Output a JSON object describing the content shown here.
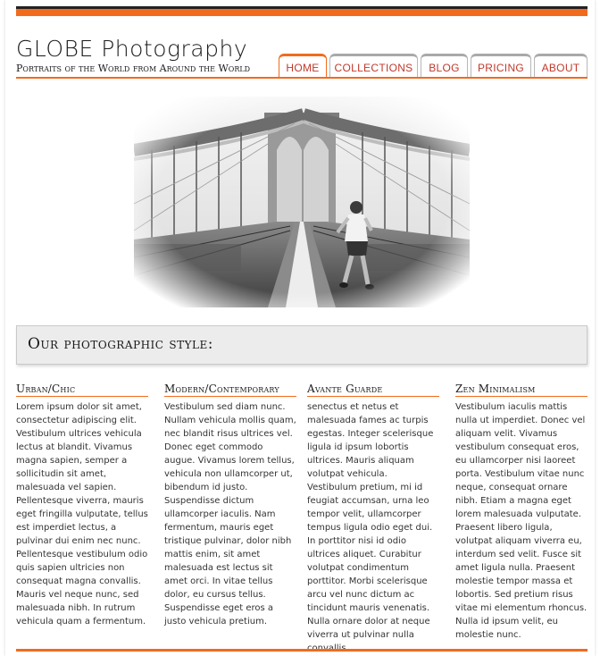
{
  "header": {
    "title": "GLOBE Photography",
    "subtitle": "Portraits of the World from Around the World"
  },
  "nav": {
    "items": [
      {
        "label": "HOME",
        "active": true
      },
      {
        "label": "COLLECTIONS",
        "active": false
      },
      {
        "label": "BLOG",
        "active": false
      },
      {
        "label": "PRICING",
        "active": false
      },
      {
        "label": "ABOUT",
        "active": false
      }
    ]
  },
  "hero": {
    "description": "Black and white photo of a man running on the Brooklyn Bridge walkway"
  },
  "style_section": {
    "heading": "Our photographic style:"
  },
  "columns": [
    {
      "heading": "Urban/Chic",
      "text": "Lorem ipsum dolor sit amet, consectetur adipiscing elit. Vestibulum ultrices vehicula lectus at blandit. Vivamus magna sapien, semper a sollicitudin sit amet, malesuada vel sapien. Pellentesque viverra, mauris eget fringilla vulputate, tellus est imperdiet lectus, a pulvinar dui enim nec nunc. Pellentesque vestibulum odio quis sapien ultricies non consequat magna convallis. Mauris vel neque nunc, sed malesuada nibh. In rutrum vehicula quam a fermentum."
    },
    {
      "heading": "Modern/Contemporary",
      "text": "Vestibulum sed diam nunc. Nullam vehicula mollis quam, nec blandit risus ultrices vel. Donec eget commodo augue. Vivamus lorem tellus, vehicula non ullamcorper ut, bibendum id justo. Suspendisse dictum ullamcorper iaculis. Nam fermentum, mauris eget tristique pulvinar, dolor nibh mattis enim, sit amet malesuada est lectus sit amet orci. In vitae tellus dolor, eu cursus tellus. Suspendisse eget eros a justo vehicula pretium."
    },
    {
      "heading": "Avante Guarde",
      "text": "senectus et netus et malesuada fames ac turpis egestas. Integer scelerisque ligula id ipsum lobortis ultrices. Mauris aliquam volutpat vehicula. Vestibulum pretium, mi id feugiat accumsan, urna leo tempor velit, ullamcorper tempus ligula odio eget dui. In porttitor nisi id odio ultrices aliquet. Curabitur volutpat condimentum porttitor. Morbi scelerisque arcu vel nunc dictum ac tincidunt mauris venenatis. Nulla ornare dolor at neque viverra ut pulvinar nulla convallis."
    },
    {
      "heading": "Zen Minimalism",
      "text": "Vestibulum iaculis mattis nulla ut imperdiet. Donec vel aliquam velit. Vivamus vestibulum consequat eros, eu ullamcorper nisi laoreet porta. Vestibulum vitae nunc neque, consequat ornare nibh. Etiam a magna eget lorem malesuada vulputate. Praesent libero ligula, volutpat aliquam viverra eu, interdum sed velit. Fusce sit amet ligula nulla. Praesent molestie tempor massa et lobortis. Sed pretium risus vitae mi elementum rhoncus. Nulla id ipsum velit, eu molestie nunc."
    }
  ],
  "colors": {
    "accent": "#f26b1d",
    "nav_text": "#c0392b",
    "dark_bar": "#222222",
    "style_box_bg": "#ececec"
  }
}
